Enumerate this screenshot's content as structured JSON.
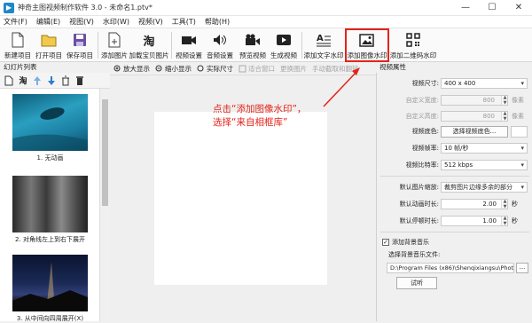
{
  "window": {
    "title": "神奇主图视频制作软件 3.0 - 未命名1.ptv*",
    "minimize": "—",
    "maximize": "☐",
    "close": "✕"
  },
  "menu": [
    "文件(F)",
    "编辑(E)",
    "视图(V)",
    "水印(W)",
    "视频(V)",
    "工具(T)",
    "帮助(H)"
  ],
  "toolbar": {
    "new_project": "新建项目",
    "open_project": "打开项目",
    "save_project": "保存项目",
    "add_image": "添加图片",
    "load_tb_image": "加载宝贝图片",
    "video_settings": "视频设置",
    "audio_settings": "音频设置",
    "preview_video": "预览视频",
    "generate_video": "生成视频",
    "add_text_watermark": "添加文字水印",
    "add_image_watermark": "添加图像水印",
    "add_qrcode_watermark": "添加二维码水印",
    "accent": "#e3231a"
  },
  "slides": {
    "title": "幻灯片列表",
    "items": [
      {
        "caption": "1. 无动画"
      },
      {
        "caption": "2. 对角线左上到右下展开"
      },
      {
        "caption": "3. 从中间向四周展开(X)"
      }
    ]
  },
  "canvas_toolbar": {
    "zoom_in": "放大显示",
    "zoom_out": "缩小显示",
    "actual_size": "实际尺寸",
    "fit_window": "适合窗口",
    "replace_image": "更换图片",
    "manual_crop": "手动截取和翻转"
  },
  "annotation": {
    "line1": "点击“添加图像水印”，",
    "line2": "选择“来自相框库”"
  },
  "props": {
    "title": "视频属性",
    "video_size_label": "视频尺寸:",
    "video_size_value": "400 x 400",
    "custom_width_label": "自定义宽度:",
    "custom_width_value": "800",
    "custom_height_label": "自定义高度:",
    "custom_height_value": "800",
    "unit_px": "像素",
    "video_bg_label": "视频底色:",
    "video_bg_button": "选择视频底色...",
    "frame_rate_label": "视频帧率:",
    "frame_rate_value": "10 帧/秒",
    "bitrate_label": "视频比特率:",
    "bitrate_value": "512 kbps",
    "scale_label": "默认图片缩放:",
    "scale_value": "裁剪图片边缘多余的部分",
    "anim_duration_label": "默认动画时长:",
    "anim_duration_value": "2.00",
    "pause_duration_label": "默认停顿时长:",
    "pause_duration_value": "1.00",
    "unit_sec": "秒",
    "bg_music_check": "添加背景音乐",
    "bg_music_checked": true,
    "bg_music_file_label": "选择背景音乐文件:",
    "bg_music_file_value": "D:\\Program Files (x86)\\Shenqixiangsu\\Phot ...",
    "browse_button": "...",
    "listen_button": "试听"
  }
}
